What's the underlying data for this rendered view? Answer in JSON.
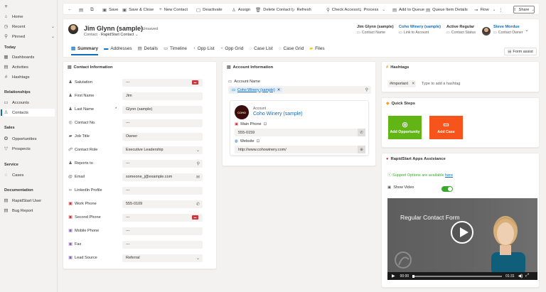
{
  "sidebar": {
    "nav": [
      {
        "icon": "home-icon",
        "glyph": "⌂",
        "label": "Home"
      },
      {
        "icon": "recent-icon",
        "glyph": "◷",
        "label": "Recent"
      },
      {
        "icon": "pin-icon",
        "glyph": "⚲",
        "label": "Pinned"
      }
    ],
    "sections": [
      {
        "title": "Today",
        "items": [
          {
            "icon": "dashboard-icon",
            "glyph": "▦",
            "label": "Dashboards"
          },
          {
            "icon": "activity-icon",
            "glyph": "▤",
            "label": "Activities"
          },
          {
            "icon": "hashtag-icon",
            "glyph": "#",
            "label": "Hashtags"
          }
        ]
      },
      {
        "title": "Relationships",
        "items": [
          {
            "icon": "accounts-icon",
            "glyph": "▭",
            "label": "Accounts"
          },
          {
            "icon": "contacts-icon",
            "glyph": "♙",
            "label": "Contacts"
          }
        ]
      },
      {
        "title": "Sales",
        "items": [
          {
            "icon": "opportunities-icon",
            "glyph": "✪",
            "label": "Opportunities"
          },
          {
            "icon": "prospects-icon",
            "glyph": "▽",
            "label": "Prospects"
          }
        ]
      },
      {
        "title": "Service",
        "items": [
          {
            "icon": "cases-icon",
            "glyph": "◌",
            "label": "Cases"
          }
        ]
      },
      {
        "title": "Documentation",
        "items": [
          {
            "icon": "doc-icon",
            "glyph": "▤",
            "label": "RapidStart User"
          },
          {
            "icon": "bug-icon",
            "glyph": "▤",
            "label": "Bug Report"
          }
        ]
      }
    ]
  },
  "toolbar": {
    "back_glyph": "←",
    "items": [
      {
        "icon": "save-icon",
        "glyph": "▣",
        "label": "Save",
        "dropdown": false
      },
      {
        "icon": "save-close-icon",
        "glyph": "▣",
        "label": "Save & Close",
        "dropdown": false
      },
      {
        "icon": "plus-icon",
        "glyph": "+",
        "label": "New Contact",
        "dropdown": false
      },
      {
        "icon": "deactivate-icon",
        "glyph": "▢",
        "label": "Deactivate",
        "dropdown": false
      },
      {
        "icon": "assign-icon",
        "glyph": "♙",
        "label": "Assign",
        "dropdown": false
      },
      {
        "icon": "delete-icon",
        "glyph": "🗑",
        "label": "Delete Contact",
        "dropdown": false
      },
      {
        "icon": "refresh-icon",
        "glyph": "↻",
        "label": "Refresh",
        "dropdown": false
      },
      {
        "icon": "check-access-icon",
        "glyph": "⚲",
        "label": "Check Access",
        "dropdown": false
      },
      {
        "icon": "process-icon",
        "glyph": "⇆",
        "label": "Process",
        "dropdown": true
      },
      {
        "icon": "queue-icon",
        "glyph": "▤",
        "label": "Add to Queue",
        "dropdown": false
      },
      {
        "icon": "queue-details-icon",
        "glyph": "▤",
        "label": "Queue Item Details",
        "dropdown": false
      },
      {
        "icon": "flow-icon",
        "glyph": "⇝",
        "label": "Flow",
        "dropdown": true
      }
    ],
    "share_label": "Share"
  },
  "record": {
    "title": "Jim Glynn (sample)",
    "unsaved": "- Unsaved",
    "entity": "Contact",
    "form_name": "RapidStart Contact",
    "header_fields": [
      {
        "value": "Jim Glynn (sample)",
        "label": "Contact Name",
        "link": false
      },
      {
        "value": "Coho Winery (sample)",
        "label": "Link to Account",
        "link": true
      },
      {
        "value": "Active Regular",
        "label": "Contact Status",
        "link": false
      },
      {
        "value": "Steve Mordue",
        "label": "Contact Owner",
        "link": true
      }
    ],
    "tabs": [
      {
        "icon": "summary-tab-icon",
        "glyph": "▤",
        "label": "Summary"
      },
      {
        "icon": "addresses-tab-icon",
        "glyph": "▬",
        "label": "Addresses"
      },
      {
        "icon": "details-tab-icon",
        "glyph": "▤",
        "label": "Details"
      },
      {
        "icon": "timeline-tab-icon",
        "glyph": "▭",
        "label": "Timeline"
      },
      {
        "icon": "opp-list-tab-icon",
        "glyph": "◔",
        "label": "Opp List"
      },
      {
        "icon": "opp-grid-tab-icon",
        "glyph": "◔",
        "label": "Opp Grid"
      },
      {
        "icon": "case-list-tab-icon",
        "glyph": "◌",
        "label": "Case List"
      },
      {
        "icon": "case-grid-tab-icon",
        "glyph": "◌",
        "label": "Case Grid"
      },
      {
        "icon": "files-tab-icon",
        "glyph": "▰",
        "label": "Files"
      }
    ],
    "form_assist": "Form assist"
  },
  "contact_info": {
    "title": "Contact Information",
    "fields": [
      {
        "icon": "salutation-icon",
        "glyph": "♟",
        "label": "Salutation",
        "value": "---",
        "required": false,
        "suffix": "red"
      },
      {
        "icon": "person-icon",
        "glyph": "♟",
        "label": "First Name",
        "value": "Jim",
        "required": false,
        "suffix": ""
      },
      {
        "icon": "person-icon",
        "glyph": "♟",
        "label": "Last Name",
        "value": "Glynn (sample)",
        "required": true,
        "suffix": ""
      },
      {
        "icon": "contact-no-icon",
        "glyph": "◎",
        "label": "Contact No.",
        "value": "---",
        "required": false,
        "suffix": ""
      },
      {
        "icon": "job-title-icon",
        "glyph": "▰",
        "label": "Job Title",
        "value": "Owner",
        "required": false,
        "suffix": ""
      },
      {
        "icon": "contact-role-icon",
        "glyph": "☍",
        "label": "Contact Role",
        "value": "Executive Leadership",
        "required": false,
        "suffix": "chevron"
      },
      {
        "icon": "reports-to-icon",
        "glyph": "♟",
        "label": "Reports to",
        "value": "---",
        "required": false,
        "suffix": "search"
      },
      {
        "icon": "email-icon",
        "glyph": "@",
        "label": "Email",
        "value": "someone_j@example.com",
        "required": false,
        "suffix": "mail"
      },
      {
        "icon": "linkedin-icon",
        "glyph": "∞",
        "label": "LinkedIn Profile",
        "value": "---",
        "required": false,
        "suffix": ""
      },
      {
        "icon": "work-phone-icon",
        "glyph": "▣",
        "label": "Work Phone",
        "value": "555-0109",
        "required": false,
        "suffix": "phone"
      },
      {
        "icon": "second-phone-icon",
        "glyph": "▣",
        "label": "Second Phone",
        "value": "---",
        "required": false,
        "suffix": "red"
      },
      {
        "icon": "mobile-phone-icon",
        "glyph": "▣",
        "label": "Mobile Phone",
        "value": "---",
        "required": false,
        "suffix": ""
      },
      {
        "icon": "fax-icon",
        "glyph": "▣",
        "label": "Fax",
        "value": "---",
        "required": false,
        "suffix": ""
      },
      {
        "icon": "lead-source-icon",
        "glyph": "▣",
        "label": "Lead Source",
        "value": "Referral",
        "required": false,
        "suffix": "chevron"
      }
    ]
  },
  "account_info": {
    "title": "Account Information",
    "account_name_label": "Account Name",
    "account_value": "Coho Winery (sample)",
    "card": {
      "logo_text": "COHO",
      "entity": "Account",
      "name": "Coho Winery (sample)",
      "main_phone_label": "Main Phone",
      "main_phone": "555-0159",
      "website_label": "Website",
      "website": "http://www.cohowinery.com/"
    }
  },
  "hashtags": {
    "title": "Hashtags",
    "chip": "#important",
    "placeholder": "Type to add a hashtag"
  },
  "quick_steps": {
    "title": "Quick Steps",
    "buttons": [
      {
        "label": "Add Opportunity",
        "color": "#61b514"
      },
      {
        "label": "Add Case",
        "color": "#f7541c"
      }
    ]
  },
  "assistance": {
    "title": "RapidStart Apps Assistance",
    "support_text": "Support Options are available",
    "support_link": "here",
    "show_video_label": "Show Video",
    "show_video_on": true,
    "video_title": "Regular Contact Form",
    "time_current": "00:00",
    "time_total": "01:31"
  },
  "colors": {
    "accent": "#0f6cbd",
    "add_opportunity": "#61b514",
    "add_case": "#f7541c",
    "toggle_on": "#3aa82b"
  }
}
